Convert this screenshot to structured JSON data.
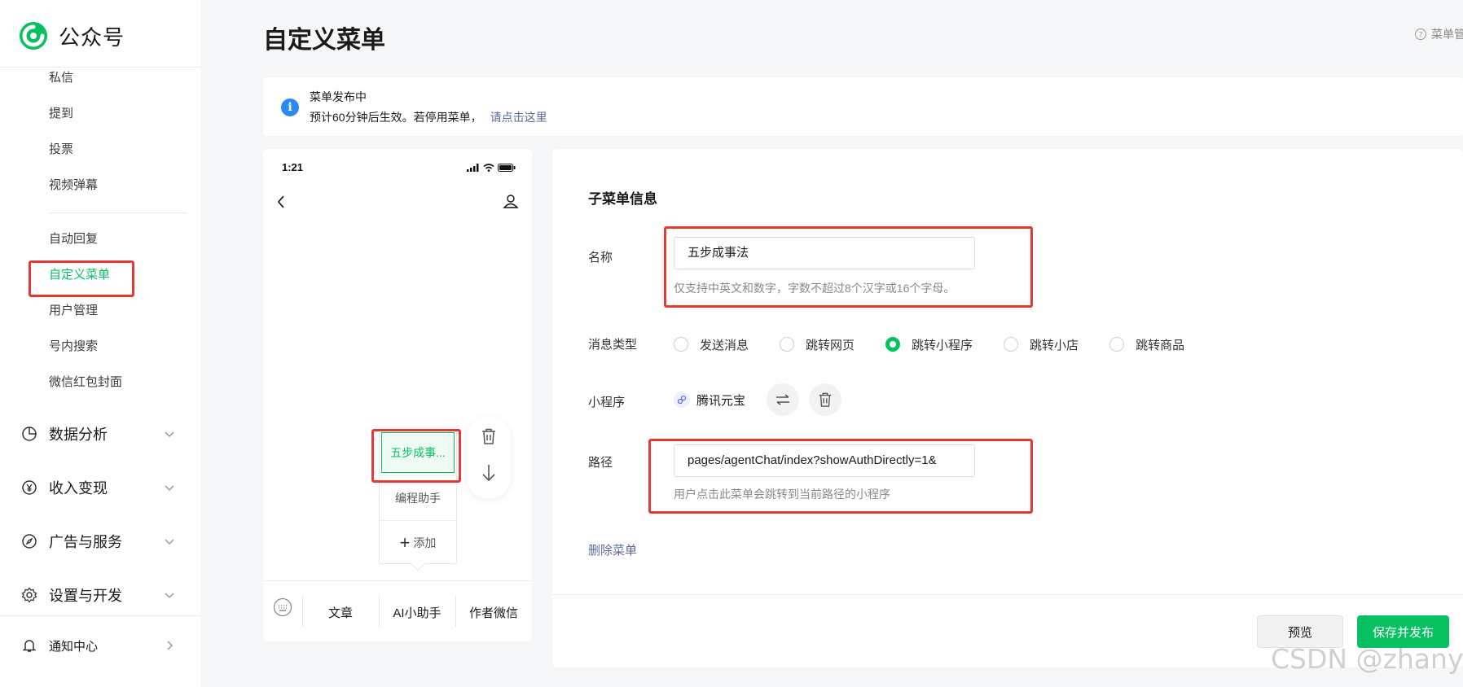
{
  "app": {
    "brand": "公众号",
    "brand_color": "#07c160"
  },
  "sidebar": {
    "items": [
      {
        "label": "私信"
      },
      {
        "label": "提到"
      },
      {
        "label": "投票"
      },
      {
        "label": "视频弹幕"
      },
      {
        "label": "自动回复"
      },
      {
        "label": "自定义菜单",
        "active": true
      },
      {
        "label": "用户管理"
      },
      {
        "label": "号内搜索"
      },
      {
        "label": "微信红包封面"
      }
    ],
    "groups": [
      {
        "label": "数据分析",
        "icon": "pie-chart-icon"
      },
      {
        "label": "收入变现",
        "icon": "yen-icon"
      },
      {
        "label": "广告与服务",
        "icon": "compass-icon"
      },
      {
        "label": "设置与开发",
        "icon": "gear-icon"
      }
    ],
    "notifications": {
      "label": "通知中心",
      "icon": "bell-icon"
    }
  },
  "page": {
    "title": "自定义菜单",
    "help_label": "菜单管"
  },
  "notice": {
    "title": "菜单发布中",
    "text": "预计60分钟后生效。若停用菜单，",
    "link": "请点击这里"
  },
  "phone": {
    "time": "1:21",
    "submenu": [
      {
        "label": "五步成事...",
        "selected": true
      },
      {
        "label": "编程助手"
      },
      {
        "label": "添加",
        "icon": "plus-icon"
      }
    ],
    "bottom_menu": [
      "文章",
      "AI小助手",
      "作者微信"
    ]
  },
  "form": {
    "title": "子菜单信息",
    "name_label": "名称",
    "name_value": "五步成事法",
    "name_hint": "仅支持中英文和数字，字数不超过8个汉字或16个字母。",
    "type_label": "消息类型",
    "types": [
      {
        "label": "发送消息",
        "checked": false
      },
      {
        "label": "跳转网页",
        "checked": false
      },
      {
        "label": "跳转小程序",
        "checked": true
      },
      {
        "label": "跳转小店",
        "checked": false
      },
      {
        "label": "跳转商品",
        "checked": false
      }
    ],
    "miniprogram_label": "小程序",
    "miniprogram_name": "腾讯元宝",
    "path_label": "路径",
    "path_value": "pages/agentChat/index?showAuthDirectly=1&",
    "path_hint": "用户点击此菜单会跳转到当前路径的小程序",
    "delete_label": "删除菜单",
    "preview_label": "预览",
    "save_label": "保存并发布"
  },
  "watermark": "CSDN @zhanyd"
}
